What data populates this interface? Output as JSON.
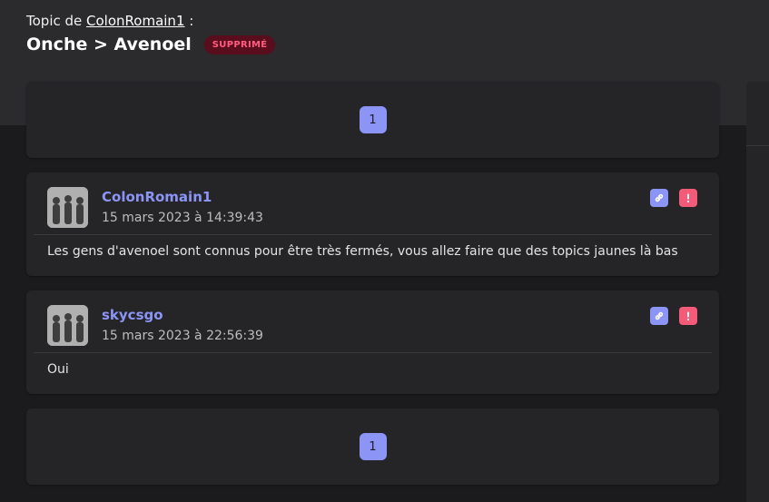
{
  "header": {
    "topic_prefix": "Topic de",
    "author": "ColonRomain1",
    "topic_suffix": ":",
    "title": "Onche > Avenoel",
    "badge": "SUPPRIMÉ"
  },
  "pagination": {
    "current_page": "1"
  },
  "posts": [
    {
      "author": "ColonRomain1",
      "date": "15 mars 2023 à 14:39:43",
      "text": "Les gens d'avenoel sont connus pour être très fermés, vous allez faire que des topics jaunes là bas"
    },
    {
      "author": "skycsgo",
      "date": "15 mars 2023 à 22:56:39",
      "text": "Oui"
    }
  ],
  "icons": {
    "permalink": "link-icon",
    "report": "exclamation-icon"
  },
  "colors": {
    "accent": "#8c95f5",
    "danger": "#f35b79",
    "badge_bg": "#5a0d1c",
    "badge_text": "#ff5d80"
  }
}
